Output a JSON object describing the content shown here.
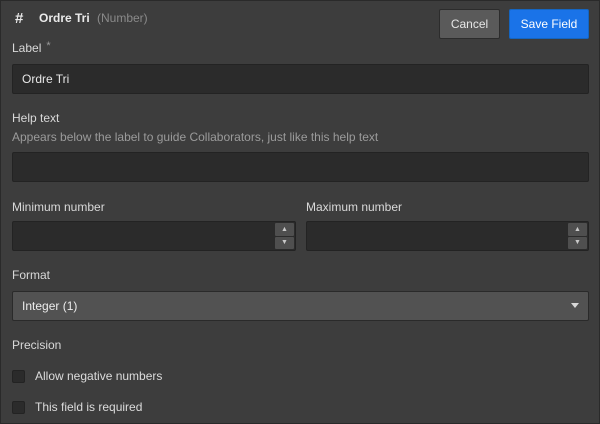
{
  "header": {
    "icon": "hash-icon",
    "title": "Ordre Tri",
    "type": "(Number)",
    "cancel_label": "Cancel",
    "save_label": "Save Field"
  },
  "label_field": {
    "label": "Label",
    "required_mark": "*",
    "value": "Ordre Tri"
  },
  "help_text": {
    "label": "Help text",
    "description": "Appears below the label to guide Collaborators, just like this help text",
    "value": ""
  },
  "minimum": {
    "label": "Minimum number",
    "value": ""
  },
  "maximum": {
    "label": "Maximum number",
    "value": ""
  },
  "format": {
    "label": "Format",
    "selected": "Integer (1)"
  },
  "precision": {
    "label": "Precision"
  },
  "options": {
    "allow_negative": {
      "label": "Allow negative numbers",
      "checked": false
    },
    "required": {
      "label": "This field is required",
      "checked": false
    }
  },
  "colors": {
    "background": "#3d3d3d",
    "input_bg": "#2b2b2b",
    "accent": "#1a73e8",
    "secondary_button": "#5a5a5a"
  }
}
